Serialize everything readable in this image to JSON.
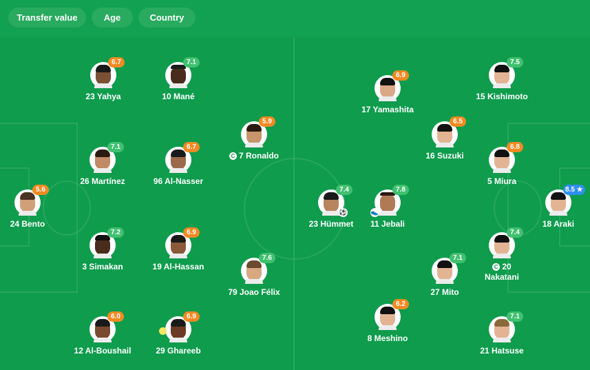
{
  "tabs": [
    {
      "label": "Transfer value"
    },
    {
      "label": "Age"
    },
    {
      "label": "Country"
    }
  ],
  "colors": {
    "orange": "#f08a24",
    "green": "#41c070",
    "blue": "#2f8ff0"
  },
  "players": [
    {
      "name": "23 Yahya",
      "rating": "6.7",
      "rc": "orange"
    },
    {
      "name": "10 Mané",
      "rating": "7.1",
      "rc": "green"
    },
    {
      "name": "26 Martínez",
      "rating": "7.1",
      "rc": "green"
    },
    {
      "name": "96 Al-Nasser",
      "rating": "6.7",
      "rc": "orange"
    },
    {
      "name": "7 Ronaldo",
      "rating": "5.9",
      "rc": "orange",
      "captain": true
    },
    {
      "name": "24 Bento",
      "rating": "5.6",
      "rc": "orange"
    },
    {
      "name": "3 Simakan",
      "rating": "7.2",
      "rc": "green"
    },
    {
      "name": "19 Al-Hassan",
      "rating": "6.9",
      "rc": "orange"
    },
    {
      "name": "79 Joao Félix",
      "rating": "7.6",
      "rc": "green"
    },
    {
      "name": "12 Al-Boushail",
      "rating": "6.0",
      "rc": "orange"
    },
    {
      "name": "29 Ghareeb",
      "rating": "6.9",
      "rc": "orange",
      "yellow_card": true
    },
    {
      "name": "17 Yamashita",
      "rating": "6.9",
      "rc": "orange"
    },
    {
      "name": "15 Kishimoto",
      "rating": "7.5",
      "rc": "green"
    },
    {
      "name": "16 Suzuki",
      "rating": "6.5",
      "rc": "orange"
    },
    {
      "name": "5 Miura",
      "rating": "6.8",
      "rc": "orange"
    },
    {
      "name": "23 Hümmet",
      "rating": "7.4",
      "rc": "green",
      "event": "goal"
    },
    {
      "name": "11 Jebali",
      "rating": "7.8",
      "rc": "green",
      "event": "assist"
    },
    {
      "name": "18 Araki",
      "rating": "8.5 ★",
      "rc": "blue"
    },
    {
      "name": "20 Nakatani",
      "rating": "7.4",
      "rc": "green",
      "captain": true
    },
    {
      "name": "27 Mito",
      "rating": "7.1",
      "rc": "green"
    },
    {
      "name": "8 Meshino",
      "rating": "6.2",
      "rc": "orange"
    },
    {
      "name": "21 Hatsuse",
      "rating": "7.1",
      "rc": "green"
    }
  ]
}
